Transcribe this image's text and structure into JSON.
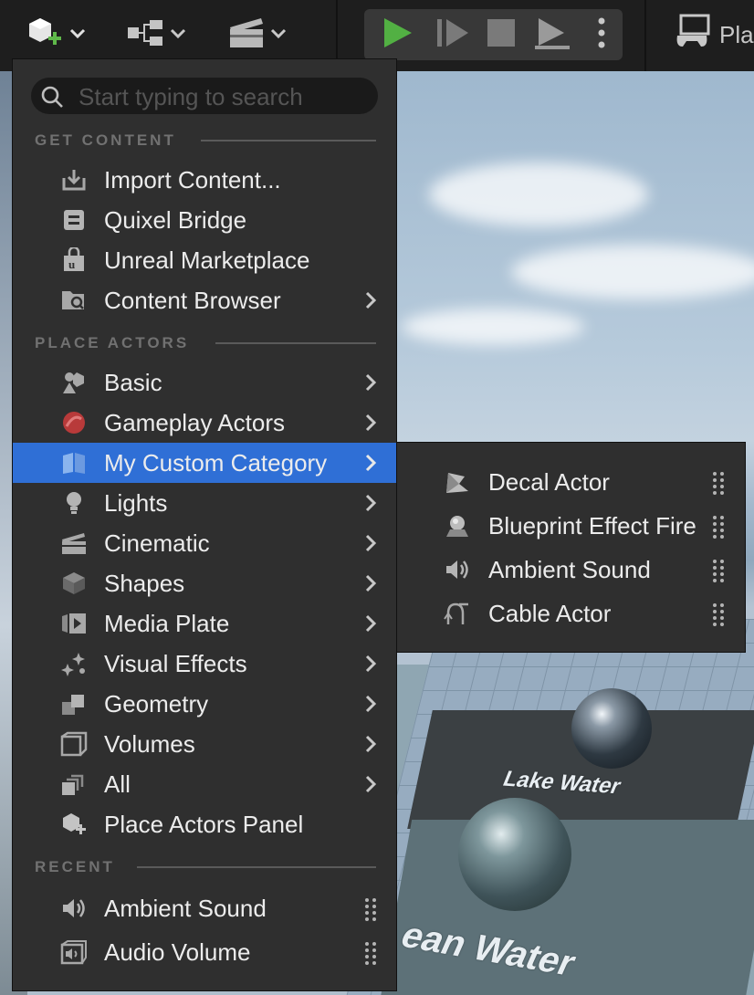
{
  "toolbar": {
    "add_icon": "add-actor-icon",
    "blueprint_icon": "blueprint-icon",
    "cinematic_icon": "clapperboard-icon",
    "play_icon": "play-icon",
    "advance_icon": "advance-frame-icon",
    "stop_icon": "stop-icon",
    "eject_icon": "eject-icon",
    "more_icon": "more-vertical-icon",
    "platforms_label": "Pla",
    "colors": {
      "play": "#4caf50",
      "accent": "#2f6fd6"
    }
  },
  "search": {
    "placeholder": "Start typing to search",
    "value": ""
  },
  "sections": {
    "get_content": "GET CONTENT",
    "place_actors": "PLACE ACTORS",
    "recent": "RECENT"
  },
  "get_content_items": [
    {
      "label": "Import Content...",
      "icon": "import-icon",
      "submenu": false
    },
    {
      "label": "Quixel Bridge",
      "icon": "quixel-bridge-icon",
      "submenu": false
    },
    {
      "label": "Unreal Marketplace",
      "icon": "marketplace-icon",
      "submenu": false
    },
    {
      "label": "Content Browser",
      "icon": "content-browser-icon",
      "submenu": true
    }
  ],
  "place_actor_items": [
    {
      "label": "Basic",
      "icon": "basic-icon",
      "submenu": true
    },
    {
      "label": "Gameplay Actors",
      "icon": "gameplay-icon",
      "submenu": true
    },
    {
      "label": "My Custom Category",
      "icon": "custom-category-icon",
      "submenu": true,
      "highlighted": true
    },
    {
      "label": "Lights",
      "icon": "light-icon",
      "submenu": true
    },
    {
      "label": "Cinematic",
      "icon": "cinematic-icon",
      "submenu": true
    },
    {
      "label": "Shapes",
      "icon": "cube-icon",
      "submenu": true
    },
    {
      "label": "Media Plate",
      "icon": "media-plate-icon",
      "submenu": true
    },
    {
      "label": "Visual Effects",
      "icon": "sparkle-icon",
      "submenu": true
    },
    {
      "label": "Geometry",
      "icon": "geometry-icon",
      "submenu": true
    },
    {
      "label": "Volumes",
      "icon": "volume-icon",
      "submenu": true
    },
    {
      "label": "All",
      "icon": "all-icon",
      "submenu": true
    },
    {
      "label": "Place Actors Panel",
      "icon": "place-actors-icon",
      "submenu": false
    }
  ],
  "recent_items": [
    {
      "label": "Ambient Sound",
      "icon": "speaker-icon"
    },
    {
      "label": "Audio Volume",
      "icon": "audio-volume-icon"
    }
  ],
  "submenu_items": [
    {
      "label": "Decal Actor",
      "icon": "decal-icon"
    },
    {
      "label": "Blueprint Effect Fire",
      "icon": "blueprint-fire-icon"
    },
    {
      "label": "Ambient Sound",
      "icon": "speaker-icon"
    },
    {
      "label": "Cable Actor",
      "icon": "cable-icon"
    }
  ],
  "viewport_text": {
    "lake": "Lake Water",
    "ocean": "ean Water"
  }
}
